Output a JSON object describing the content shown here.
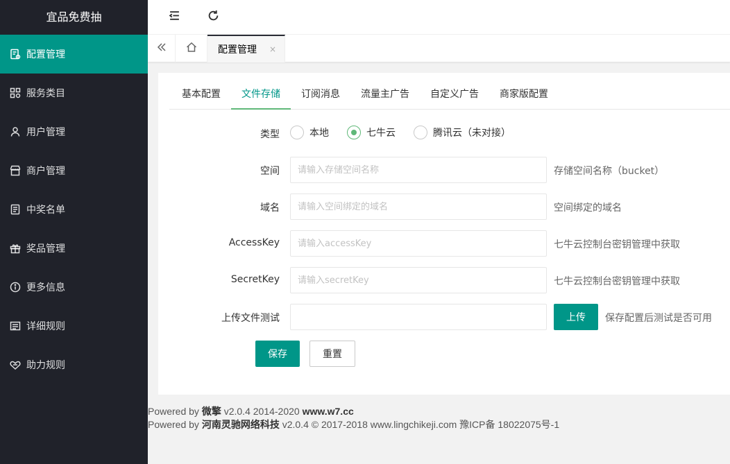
{
  "sidebar": {
    "logo": "宜品免费抽",
    "items": [
      {
        "label": "配置管理",
        "icon": "doc-settings-icon",
        "active": true
      },
      {
        "label": "服务类目",
        "icon": "grid-icon"
      },
      {
        "label": "用户管理",
        "icon": "user-icon"
      },
      {
        "label": "商户管理",
        "icon": "store-icon"
      },
      {
        "label": "中奖名单",
        "icon": "list-doc-icon"
      },
      {
        "label": "奖品管理",
        "icon": "gift-icon"
      },
      {
        "label": "更多信息",
        "icon": "info-icon"
      },
      {
        "label": "详细规则",
        "icon": "rules-icon"
      },
      {
        "label": "助力规则",
        "icon": "heart-hands-icon"
      }
    ]
  },
  "header": {
    "icons": [
      "menu-collapse-icon",
      "refresh-icon"
    ]
  },
  "tabbar": {
    "active_tab": "配置管理",
    "close": "×"
  },
  "tabs": [
    {
      "label": "基本配置"
    },
    {
      "label": "文件存储",
      "active": true
    },
    {
      "label": "订阅消息"
    },
    {
      "label": "流量主广告"
    },
    {
      "label": "自定义广告"
    },
    {
      "label": "商家版配置"
    }
  ],
  "form": {
    "type_label": "类型",
    "type_options": [
      "本地",
      "七牛云",
      "腾讯云（未对接）"
    ],
    "type_selected": "七牛云",
    "bucket_label": "空间",
    "bucket_placeholder": "请输入存储空间名称",
    "bucket_help": "存储空间名称（bucket）",
    "domain_label": "域名",
    "domain_placeholder": "请输入空间绑定的域名",
    "domain_help": "空间绑定的域名",
    "accesskey_label": "AccessKey",
    "accesskey_placeholder": "请输入accessKey",
    "accesskey_help": "七牛云控制台密钥管理中获取",
    "secretkey_label": "SecretKey",
    "secretkey_placeholder": "请输入secretKey",
    "secretkey_help": "七牛云控制台密钥管理中获取",
    "upload_label": "上传文件测试",
    "upload_button": "上传",
    "upload_help": "保存配置后测试是否可用",
    "save_button": "保存",
    "reset_button": "重置"
  },
  "footer": {
    "line1_prefix": "Powered by ",
    "line1_brand": "微擎",
    "line1_version": " v2.0.4 2014-2020 ",
    "line1_site": "www.w7.cc",
    "line2_prefix": "Powered by ",
    "line2_brand": "河南灵驰网络科技",
    "line2_rest": " v2.0.4 © 2017-2018 www.lingchikeji.com 豫ICP备 18022075号-1"
  },
  "colors": {
    "accent": "#009688",
    "sidebar_bg": "#20222a",
    "radio_checked": "#5fb878"
  }
}
